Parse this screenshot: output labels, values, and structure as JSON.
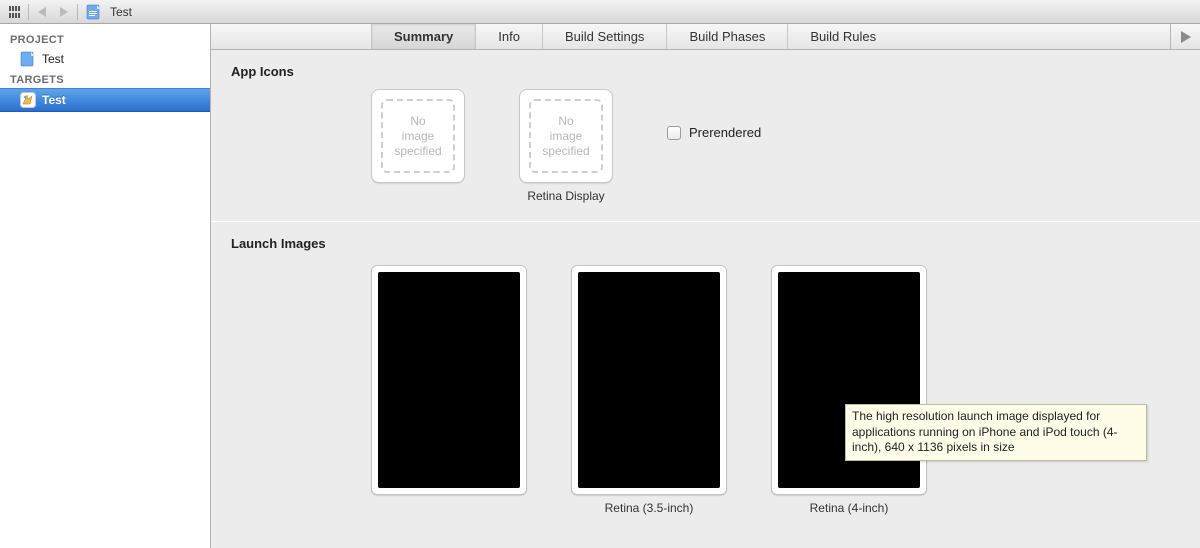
{
  "toolbar": {
    "file_name": "Test"
  },
  "sidebar": {
    "section_project": "PROJECT",
    "project_name": "Test",
    "section_targets": "TARGETS",
    "target_name": "Test"
  },
  "tabs": {
    "summary": "Summary",
    "info": "Info",
    "build_settings": "Build Settings",
    "build_phases": "Build Phases",
    "build_rules": "Build Rules"
  },
  "app_icons": {
    "section_title": "App Icons",
    "no_image_text": "No\nimage\nspecified",
    "retina_caption": "Retina Display",
    "prerendered_label": "Prerendered"
  },
  "launch_images": {
    "section_title": "Launch Images",
    "retina35_caption": "Retina (3.5-inch)",
    "retina4_caption": "Retina (4-inch)"
  },
  "tooltip": {
    "text": "The high resolution launch image displayed for applications running on iPhone and iPod touch (4-inch), 640 x 1136 pixels in size"
  }
}
